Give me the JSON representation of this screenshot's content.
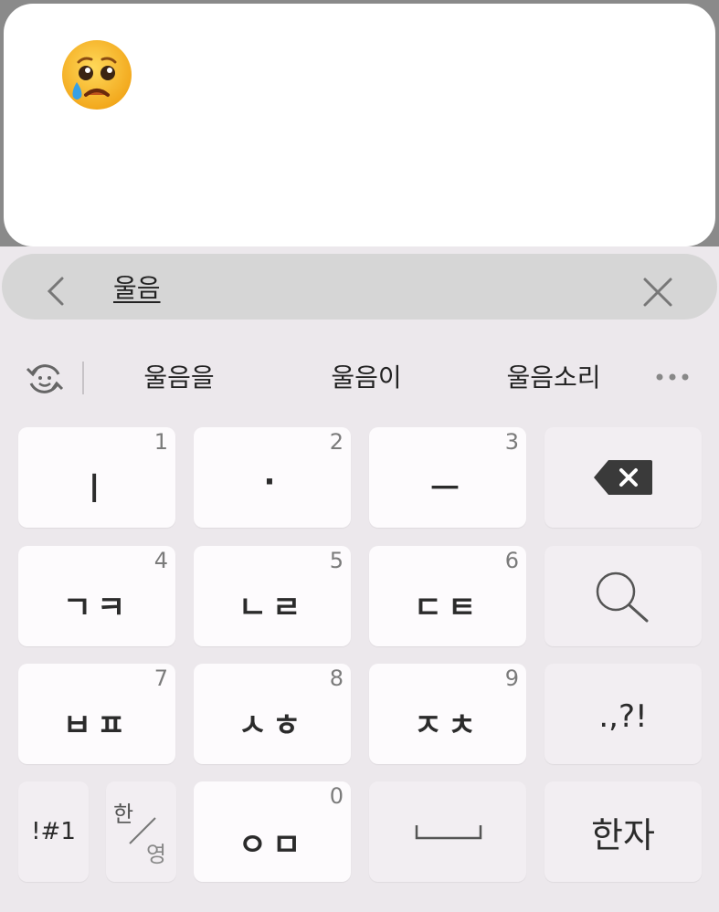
{
  "message": {
    "emoji_icon": "crying-face-emoji"
  },
  "search": {
    "query": "울음",
    "back_icon": "chevron-left-icon",
    "clear_icon": "close-icon"
  },
  "suggestions": {
    "refresh_icon": "emoji-refresh-icon",
    "items": [
      "울음을",
      "울음이",
      "울음소리"
    ],
    "more_icon": "more-horizontal-icon"
  },
  "keys": {
    "r1": [
      {
        "label": "ㅣ",
        "num": "1"
      },
      {
        "label": "·",
        "num": "2"
      },
      {
        "label": "ㅡ",
        "num": "3"
      }
    ],
    "r2": [
      {
        "label": "ㄱㅋ",
        "num": "4"
      },
      {
        "label": "ㄴㄹ",
        "num": "5"
      },
      {
        "label": "ㄷㅌ",
        "num": "6"
      }
    ],
    "r3": [
      {
        "label": "ㅂㅍ",
        "num": "7"
      },
      {
        "label": "ㅅㅎ",
        "num": "8"
      },
      {
        "label": "ㅈㅊ",
        "num": "9"
      }
    ],
    "r4_main": {
      "label": "ㅇㅁ",
      "num": "0"
    },
    "punct": ".,?!",
    "symbols": "!#1",
    "lang_top": "한",
    "lang_bottom": "영",
    "hanja": "한자",
    "backspace_icon": "backspace-icon",
    "search_icon": "search-icon",
    "space_icon": "space-bar-icon"
  }
}
